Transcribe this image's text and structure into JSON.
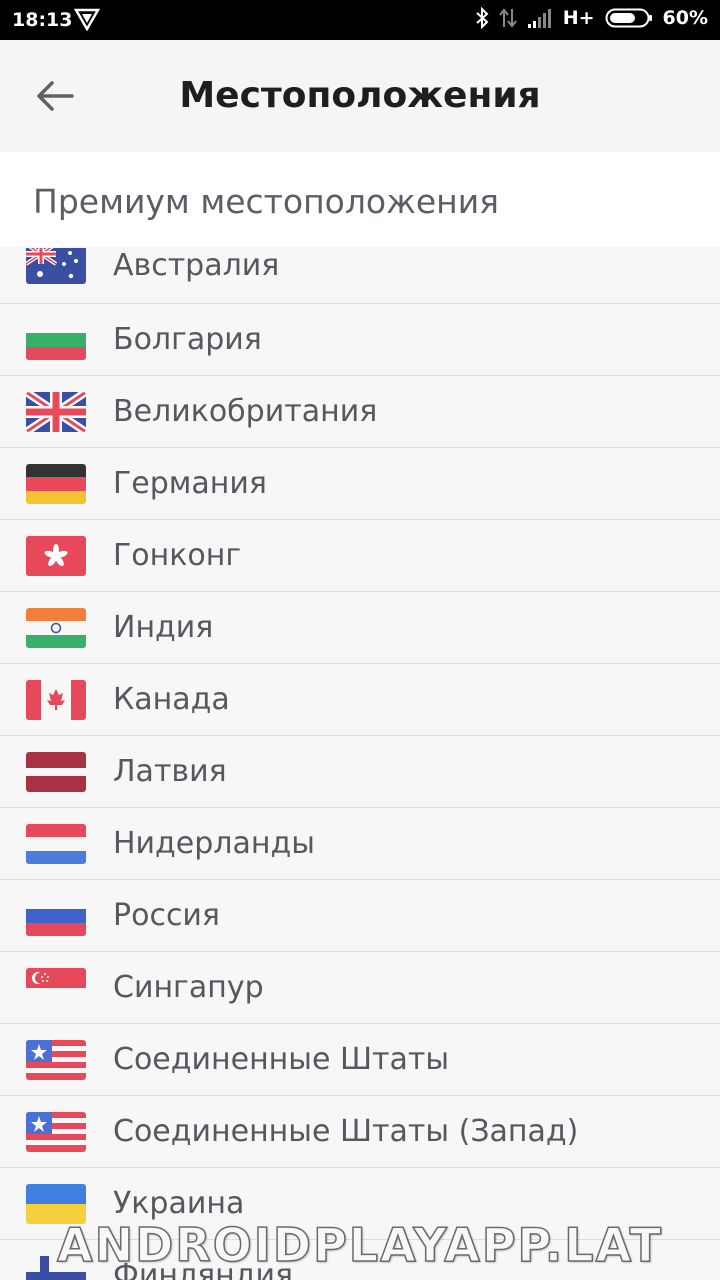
{
  "status_bar": {
    "time": "18:13",
    "network": "H+",
    "battery": "60%",
    "icons": [
      "vpn-shield-icon",
      "bluetooth-icon",
      "data-transfer-icon",
      "signal-icon",
      "battery-icon"
    ]
  },
  "app_bar": {
    "title": "Местоположения",
    "back_icon": "arrow-back-icon"
  },
  "section": {
    "title": "Премиум местоположения"
  },
  "locations": [
    {
      "name": "Австралия",
      "flag": "australia"
    },
    {
      "name": "Болгария",
      "flag": "bulgaria"
    },
    {
      "name": "Великобритания",
      "flag": "united-kingdom"
    },
    {
      "name": "Германия",
      "flag": "germany"
    },
    {
      "name": "Гонконг",
      "flag": "hong-kong"
    },
    {
      "name": "Индия",
      "flag": "india"
    },
    {
      "name": "Канада",
      "flag": "canada"
    },
    {
      "name": "Латвия",
      "flag": "latvia"
    },
    {
      "name": "Нидерланды",
      "flag": "netherlands"
    },
    {
      "name": "Россия",
      "flag": "russia"
    },
    {
      "name": "Сингапур",
      "flag": "singapore"
    },
    {
      "name": "Соединенные Штаты",
      "flag": "united-states"
    },
    {
      "name": "Соединенные Штаты (Запад)",
      "flag": "united-states"
    },
    {
      "name": "Украина",
      "flag": "ukraine"
    },
    {
      "name": "Финляндия",
      "flag": "finland"
    }
  ],
  "watermark": "ANDROIDPLAYAPP.LAT",
  "colors": {
    "status_bar_bg": "#000000",
    "app_bar_bg": "#f5f5f5",
    "list_bg": "#f7f7f7",
    "divider": "#dddddd",
    "text": "#56585f"
  }
}
